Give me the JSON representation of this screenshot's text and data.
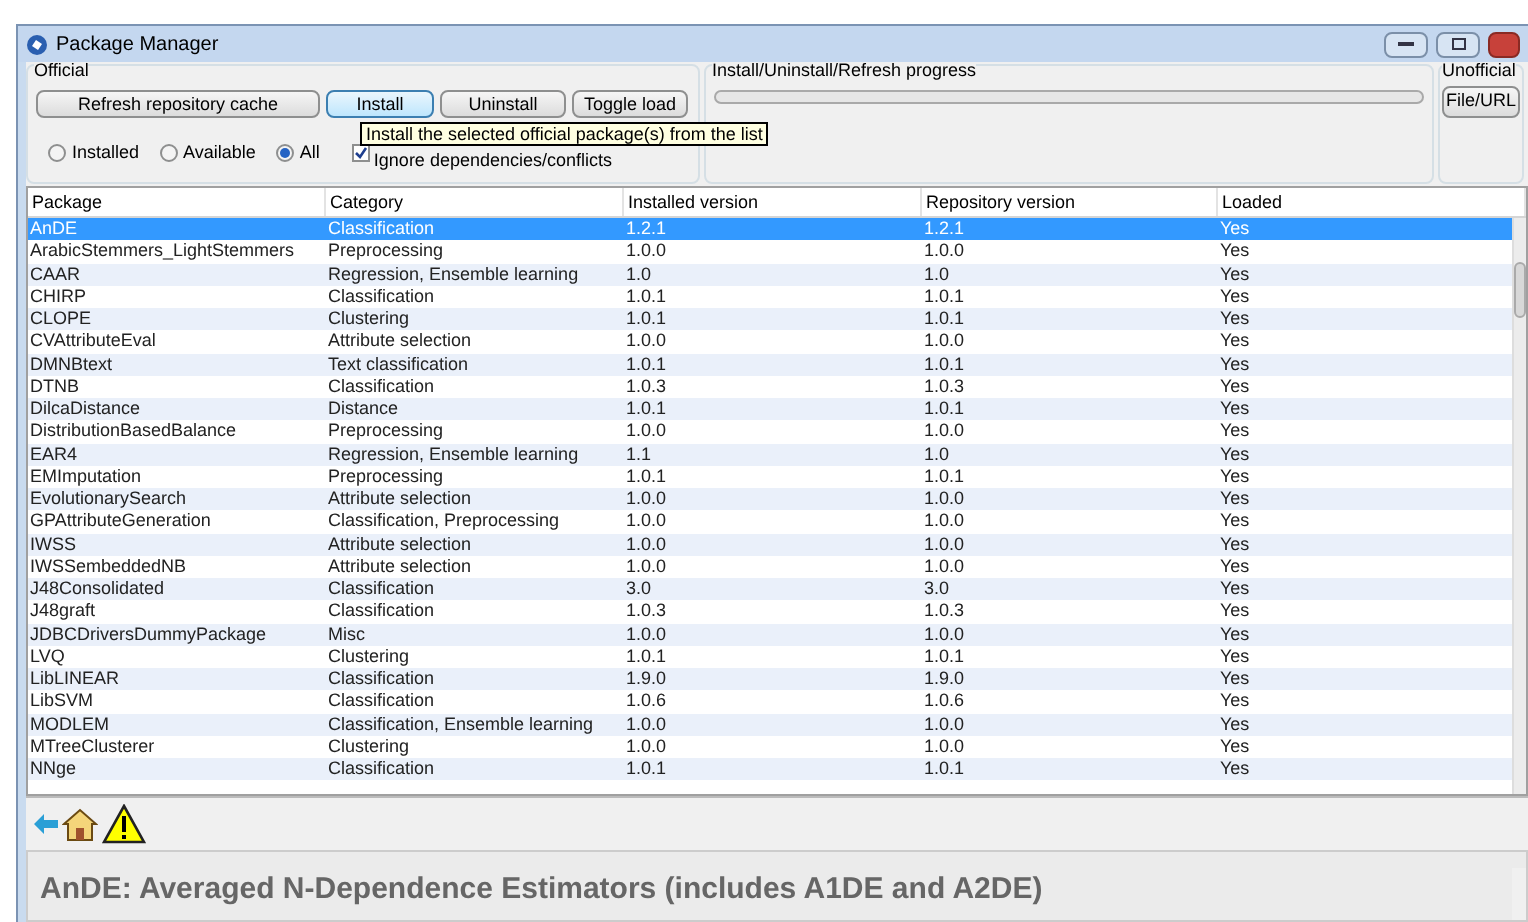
{
  "window": {
    "title": "Package Manager"
  },
  "official": {
    "label": "Official",
    "buttons": [
      {
        "label": "Refresh repository cache",
        "selected": false
      },
      {
        "label": "Install",
        "selected": true
      },
      {
        "label": "Uninstall",
        "selected": false
      },
      {
        "label": "Toggle load",
        "selected": false
      }
    ],
    "filters": [
      {
        "label": "Installed",
        "selected": false
      },
      {
        "label": "Available",
        "selected": false
      },
      {
        "label": "All",
        "selected": true
      }
    ],
    "ignore_dependencies": {
      "label": "Ignore dependencies/conflicts",
      "checked": true
    }
  },
  "tooltip": "Install the selected official package(s) from the list",
  "progress": {
    "label": "Install/Uninstall/Refresh progress"
  },
  "unofficial": {
    "label": "Unofficial",
    "button": "File/URL"
  },
  "table": {
    "columns": [
      "Package",
      "Category",
      "Installed version",
      "Repository version",
      "Loaded"
    ],
    "rows": [
      {
        "cells": [
          "AnDE",
          "Classification",
          "1.2.1",
          "1.2.1",
          "Yes"
        ],
        "selected": true
      },
      {
        "cells": [
          "ArabicStemmers_LightStemmers",
          "Preprocessing",
          "1.0.0",
          "1.0.0",
          "Yes"
        ],
        "selected": false
      },
      {
        "cells": [
          "CAAR",
          "Regression, Ensemble learning",
          "1.0",
          "1.0",
          "Yes"
        ],
        "selected": false
      },
      {
        "cells": [
          "CHIRP",
          "Classification",
          "1.0.1",
          "1.0.1",
          "Yes"
        ],
        "selected": false
      },
      {
        "cells": [
          "CLOPE",
          "Clustering",
          "1.0.1",
          "1.0.1",
          "Yes"
        ],
        "selected": false
      },
      {
        "cells": [
          "CVAttributeEval",
          "Attribute selection",
          "1.0.0",
          "1.0.0",
          "Yes"
        ],
        "selected": false
      },
      {
        "cells": [
          "DMNBtext",
          "Text classification",
          "1.0.1",
          "1.0.1",
          "Yes"
        ],
        "selected": false
      },
      {
        "cells": [
          "DTNB",
          "Classification",
          "1.0.3",
          "1.0.3",
          "Yes"
        ],
        "selected": false
      },
      {
        "cells": [
          "DilcaDistance",
          "Distance",
          "1.0.1",
          "1.0.1",
          "Yes"
        ],
        "selected": false
      },
      {
        "cells": [
          "DistributionBasedBalance",
          "Preprocessing",
          "1.0.0",
          "1.0.0",
          "Yes"
        ],
        "selected": false
      },
      {
        "cells": [
          "EAR4",
          "Regression, Ensemble learning",
          "1.1",
          "1.0",
          "Yes"
        ],
        "selected": false
      },
      {
        "cells": [
          "EMImputation",
          "Preprocessing",
          "1.0.1",
          "1.0.1",
          "Yes"
        ],
        "selected": false
      },
      {
        "cells": [
          "EvolutionarySearch",
          "Attribute selection",
          "1.0.0",
          "1.0.0",
          "Yes"
        ],
        "selected": false
      },
      {
        "cells": [
          "GPAttributeGeneration",
          "Classification, Preprocessing",
          "1.0.0",
          "1.0.0",
          "Yes"
        ],
        "selected": false
      },
      {
        "cells": [
          "IWSS",
          "Attribute selection",
          "1.0.0",
          "1.0.0",
          "Yes"
        ],
        "selected": false
      },
      {
        "cells": [
          "IWSSembeddedNB",
          "Attribute selection",
          "1.0.0",
          "1.0.0",
          "Yes"
        ],
        "selected": false
      },
      {
        "cells": [
          "J48Consolidated",
          "Classification",
          "3.0",
          "3.0",
          "Yes"
        ],
        "selected": false
      },
      {
        "cells": [
          "J48graft",
          "Classification",
          "1.0.3",
          "1.0.3",
          "Yes"
        ],
        "selected": false
      },
      {
        "cells": [
          "JDBCDriversDummyPackage",
          "Misc",
          "1.0.0",
          "1.0.0",
          "Yes"
        ],
        "selected": false
      },
      {
        "cells": [
          "LVQ",
          "Clustering",
          "1.0.1",
          "1.0.1",
          "Yes"
        ],
        "selected": false
      },
      {
        "cells": [
          "LibLINEAR",
          "Classification",
          "1.9.0",
          "1.9.0",
          "Yes"
        ],
        "selected": false
      },
      {
        "cells": [
          "LibSVM",
          "Classification",
          "1.0.6",
          "1.0.6",
          "Yes"
        ],
        "selected": false
      },
      {
        "cells": [
          "MODLEM",
          "Classification, Ensemble learning",
          "1.0.0",
          "1.0.0",
          "Yes"
        ],
        "selected": false
      },
      {
        "cells": [
          "MTreeClusterer",
          "Clustering",
          "1.0.0",
          "1.0.0",
          "Yes"
        ],
        "selected": false
      },
      {
        "cells": [
          "NNge",
          "Classification",
          "1.0.1",
          "1.0.1",
          "Yes"
        ],
        "selected": false
      }
    ]
  },
  "description": {
    "heading": "AnDE: Averaged N-Dependence Estimators (includes A1DE and A2DE)"
  }
}
